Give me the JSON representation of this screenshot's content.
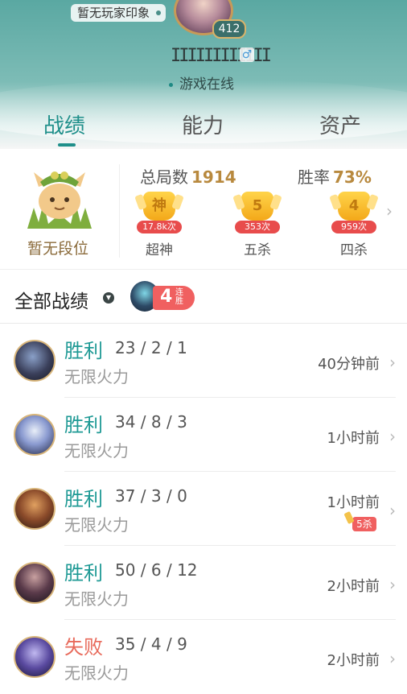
{
  "profile": {
    "impression_tag": "暂无玩家印象",
    "level": "412",
    "name_masked": "IIIIIIIIIIII",
    "gender_icon": "male-icon",
    "status": "游戏在线"
  },
  "tabs": [
    {
      "label": "战绩",
      "active": true
    },
    {
      "label": "能力",
      "active": false
    },
    {
      "label": "资产",
      "active": false
    }
  ],
  "summary": {
    "rank_label": "暂无段位",
    "total_games_label": "总局数",
    "total_games_value": "1914",
    "win_rate_label": "胜率",
    "win_rate_value": "73%",
    "badges": [
      {
        "icon": "神",
        "count": "17.8k次",
        "name": "超神"
      },
      {
        "icon": "5",
        "count": "353次",
        "name": "五杀"
      },
      {
        "icon": "4",
        "count": "959次",
        "name": "四杀"
      }
    ]
  },
  "section": {
    "title": "全部战绩",
    "streak_count": "4",
    "streak_label": "连胜"
  },
  "matches": [
    {
      "result": "胜利",
      "kda": "23 / 2 / 1",
      "mode": "无限火力",
      "time": "40分钟前",
      "win": true
    },
    {
      "result": "胜利",
      "kda": "34 / 8 / 3",
      "mode": "无限火力",
      "time": "1小时前",
      "win": true
    },
    {
      "result": "胜利",
      "kda": "37 / 3 / 0",
      "mode": "无限火力",
      "time": "1小时前",
      "win": true,
      "badge": "5杀"
    },
    {
      "result": "胜利",
      "kda": "50 / 6 / 12",
      "mode": "无限火力",
      "time": "2小时前",
      "win": true
    },
    {
      "result": "失败",
      "kda": "35 / 4 / 9",
      "mode": "无限火力",
      "time": "2小时前",
      "win": false
    }
  ],
  "colors": {
    "accent": "#1f8f8a",
    "win": "#1f9a95",
    "lose": "#e86a5b",
    "gold": "#b8893e",
    "badge_red": "#f06060"
  }
}
